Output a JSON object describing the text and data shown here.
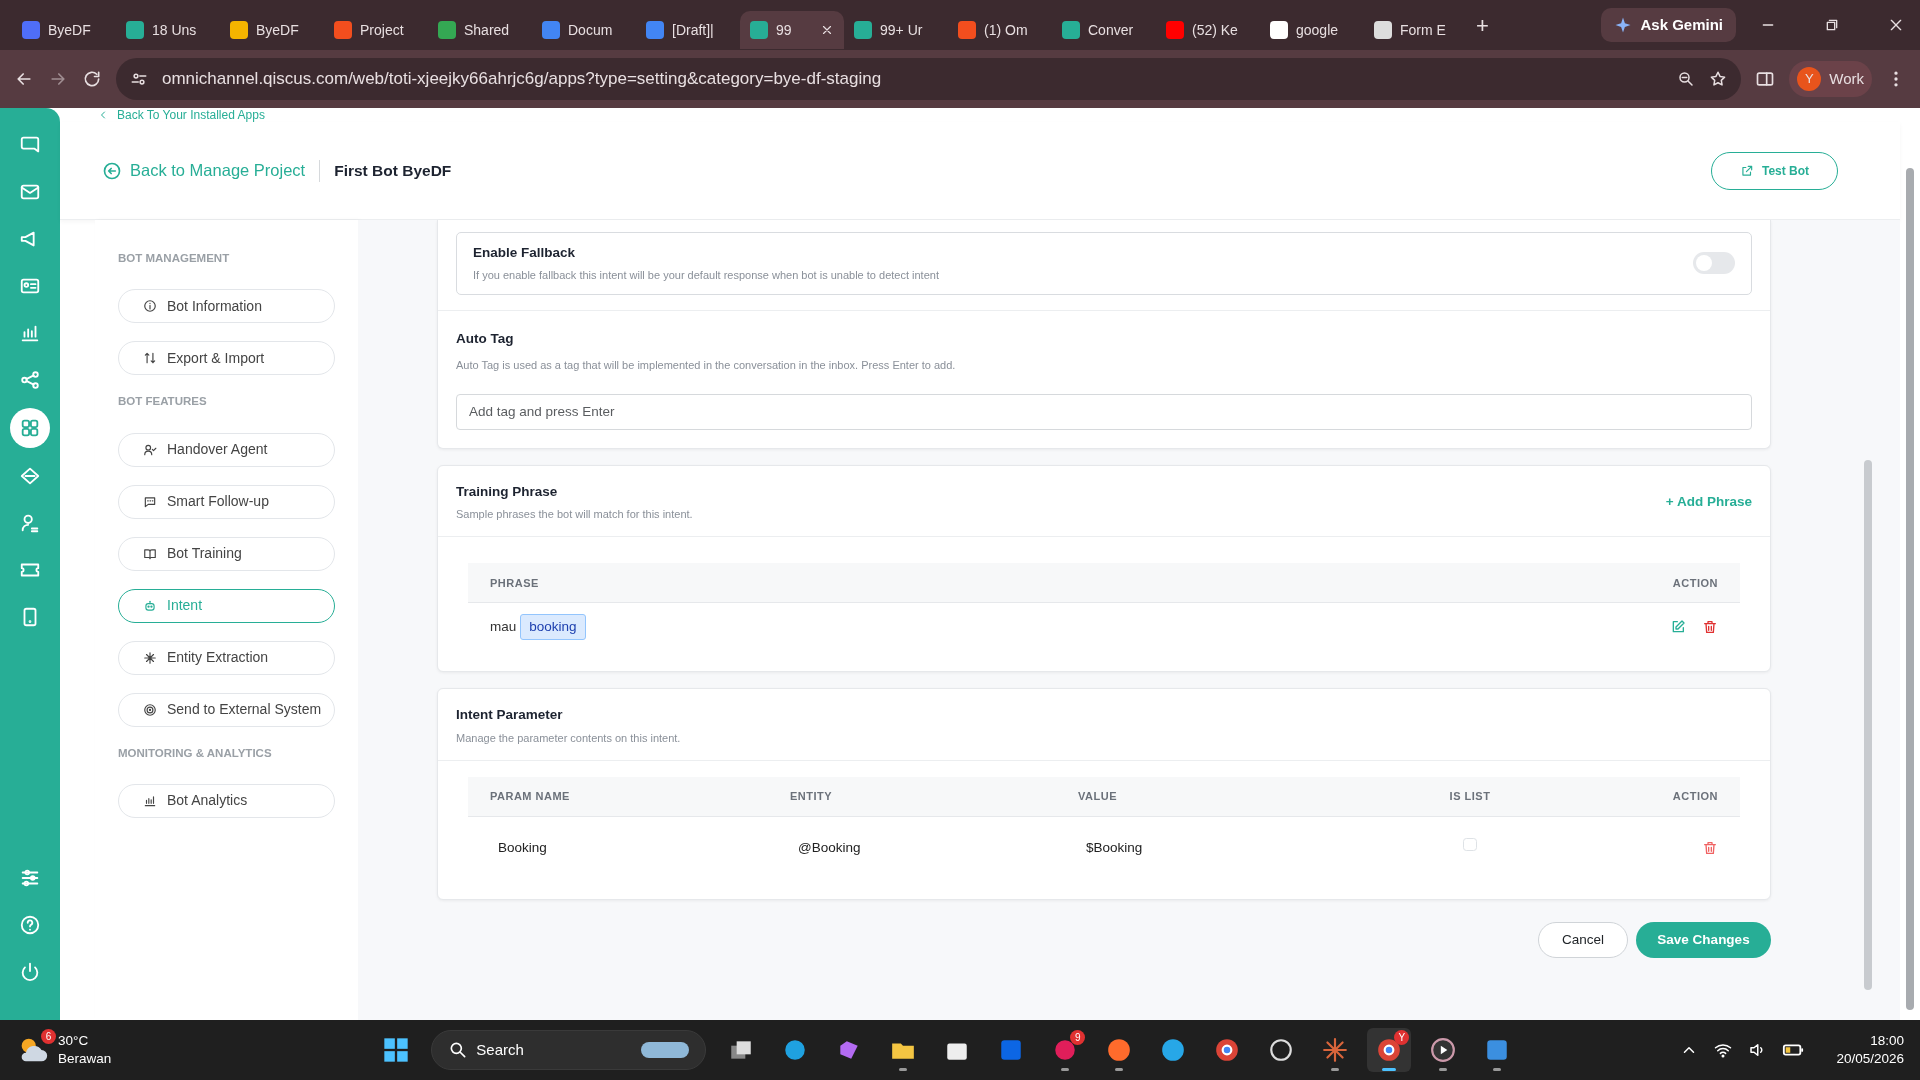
{
  "browser": {
    "tabs": [
      {
        "title": "ByeDF",
        "selected": false,
        "color": "#4f6ef7"
      },
      {
        "title": "18 Uns",
        "selected": false,
        "color": "#27ae96"
      },
      {
        "title": "ByeDF",
        "selected": false,
        "color": "#f4b400"
      },
      {
        "title": "Project",
        "selected": false,
        "color": "#f24e1e"
      },
      {
        "title": "Shared",
        "selected": false,
        "color": "#34a853"
      },
      {
        "title": "Docum",
        "selected": false,
        "color": "#4285f4"
      },
      {
        "title": "[Draft]|",
        "selected": false,
        "color": "#4285f4"
      },
      {
        "title": "99",
        "selected": true,
        "color": "#27ae96"
      },
      {
        "title": "99+ Ur",
        "selected": false,
        "color": "#27ae96"
      },
      {
        "title": "(1) Om",
        "selected": false,
        "color": "#f24e1e"
      },
      {
        "title": "Conver",
        "selected": false,
        "color": "#27ae96"
      },
      {
        "title": "(52) Ke",
        "selected": false,
        "color": "#ff0000"
      },
      {
        "title": "google",
        "selected": false,
        "color": "#ffffff"
      },
      {
        "title": "Form E",
        "selected": false,
        "color": "#dddddd"
      }
    ],
    "new_tab": "+",
    "gemini": "Ask Gemini",
    "url": "omnichannel.qiscus.com/web/toti-xjeejky66ahrjc6g/apps?type=setting&category=bye-df-staging",
    "profile": {
      "initial": "Y",
      "label": "Work"
    }
  },
  "rail": {
    "items": [
      {
        "selected": false
      },
      {
        "selected": false
      },
      {
        "selected": false
      },
      {
        "selected": false
      },
      {
        "selected": false
      },
      {
        "selected": false
      },
      {
        "selected": true
      },
      {
        "selected": false
      },
      {
        "selected": false
      },
      {
        "selected": false
      },
      {
        "selected": false
      }
    ],
    "bottom": [
      {
        "selected": false
      },
      {
        "selected": false
      },
      {
        "selected": false
      }
    ]
  },
  "top_link": "Back To Your Installed Apps",
  "header": {
    "back": "Back to Manage Project",
    "title": "First Bot ByeDF",
    "test_bot": "Test Bot"
  },
  "menu": [
    {
      "title": "BOT MANAGEMENT",
      "items": [
        {
          "label": "Bot Information",
          "selected": false
        },
        {
          "label": "Export & Import",
          "selected": false
        }
      ]
    },
    {
      "title": "BOT FEATURES",
      "items": [
        {
          "label": "Handover Agent",
          "selected": false
        },
        {
          "label": "Smart Follow-up",
          "selected": false
        },
        {
          "label": "Bot Training",
          "selected": false
        },
        {
          "label": "Intent",
          "selected": true
        },
        {
          "label": "Entity Extraction",
          "selected": false
        },
        {
          "label": "Send to External System",
          "selected": false
        }
      ]
    },
    {
      "title": "MONITORING & ANALYTICS",
      "items": [
        {
          "label": "Bot Analytics",
          "selected": false
        }
      ]
    }
  ],
  "fallback": {
    "title": "Enable Fallback",
    "description": "If you enable fallback this intent will be your default response when bot is unable to detect intent",
    "on": false
  },
  "auto_tag": {
    "title": "Auto Tag",
    "description": "Auto Tag is used as a tag that will be implemented in the conversation in the inbox. Press Enter to add.",
    "placeholder": "Add tag and press Enter"
  },
  "training": {
    "title": "Training Phrase",
    "description": "Sample phrases the bot will match for this intent.",
    "add": "+ Add Phrase",
    "columns": [
      "PHRASE",
      "ACTION"
    ],
    "rows": [
      {
        "words": [
          {
            "text": "mau",
            "kind": "plain"
          },
          {
            "text": "booking",
            "kind": "entity"
          }
        ]
      }
    ]
  },
  "parameters": {
    "title": "Intent Parameter",
    "description": "Manage the parameter contents on this intent.",
    "columns": [
      "PARAM NAME",
      "ENTITY",
      "VALUE",
      "IS LIST",
      "ACTION"
    ],
    "rows": [
      {
        "param": "Booking",
        "entity": "@Booking",
        "value": "$Booking",
        "is_list": false
      }
    ]
  },
  "actions": {
    "cancel": "Cancel",
    "save": "Save Changes"
  },
  "taskbar": {
    "weather": {
      "temp": "30°C",
      "desc": "Berawan",
      "badge": "6"
    },
    "search": "Search",
    "apps": [
      {
        "running": false,
        "selected": false
      },
      {
        "running": false,
        "selected": false
      },
      {
        "running": false,
        "selected": false
      },
      {
        "running": true,
        "selected": false
      },
      {
        "running": false,
        "selected": false
      },
      {
        "running": false,
        "selected": false
      },
      {
        "running": true,
        "selected": false,
        "badge": "9"
      },
      {
        "running": true,
        "selected": false
      },
      {
        "running": false,
        "selected": false
      },
      {
        "running": false,
        "selected": false
      },
      {
        "running": false,
        "selected": false
      },
      {
        "running": true,
        "selected": false
      },
      {
        "running": true,
        "selected": true,
        "badge": "Y"
      },
      {
        "running": true,
        "selected": false
      },
      {
        "running": true,
        "selected": false
      }
    ],
    "time": "18:00",
    "date": "20/05/2026"
  }
}
